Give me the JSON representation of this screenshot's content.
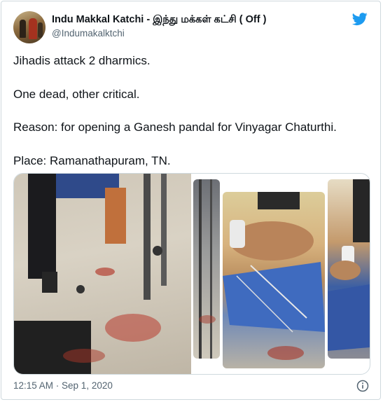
{
  "author": {
    "display_name": "Indu Makkal Katchi - இந்து மக்கள் கட்சி ( Off )",
    "handle": "@Indumakalktchi",
    "avatar_icon": "profile-photo"
  },
  "brand": {
    "icon": "twitter-bird-icon",
    "color": "#1d9bf0"
  },
  "tweet": {
    "lines": [
      "Jihadis attack 2 dharmics.",
      "One dead, other critical.",
      "Reason: for opening a Ganesh pandal for Vinyagar Chaturthi.",
      "Place: Ramanathapuram, TN."
    ],
    "media_count": 4
  },
  "footer": {
    "timestamp": "12:15 AM · Sep 1, 2020",
    "info_icon": "info-icon"
  },
  "colors": {
    "text_primary": "#0f1419",
    "text_secondary": "#536471",
    "border": "#cfd9de"
  }
}
